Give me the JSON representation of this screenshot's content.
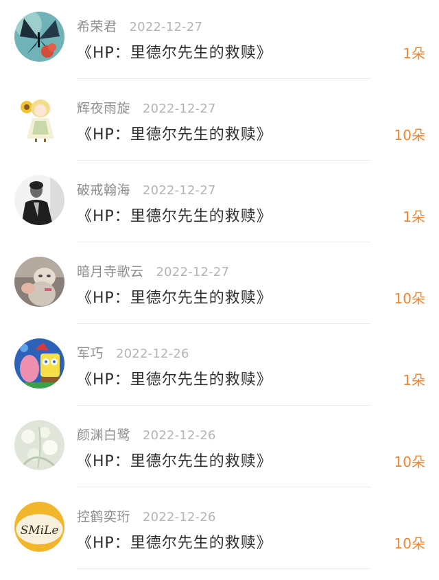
{
  "list": {
    "items": [
      {
        "name": "希荣君",
        "date": "2022-12-27",
        "title": "《HP：里德尔先生的救赎》",
        "amount": "1朵",
        "avatar": "butterfly-avatar"
      },
      {
        "name": "辉夜雨旋",
        "date": "2022-12-27",
        "title": "《HP：里德尔先生的救赎》",
        "amount": "10朵",
        "avatar": "anime-girl-avatar"
      },
      {
        "name": "破戒翰海",
        "date": "2022-12-27",
        "title": "《HP：里德尔先生的救赎》",
        "amount": "1朵",
        "avatar": "man-portrait-avatar"
      },
      {
        "name": "暗月寺歌云",
        "date": "2022-12-27",
        "title": "《HP：里德尔先生的救赎》",
        "amount": "10朵",
        "avatar": "cat-avatar"
      },
      {
        "name": "军巧",
        "date": "2022-12-26",
        "title": "《HP：里德尔先生的救赎》",
        "amount": "1朵",
        "avatar": "cartoon-avatar"
      },
      {
        "name": "颜渊白鹭",
        "date": "2022-12-26",
        "title": "《HP：里德尔先生的救赎》",
        "amount": "10朵",
        "avatar": "flowers-avatar"
      },
      {
        "name": "控鹤奕珩",
        "date": "2022-12-26",
        "title": "《HP：里德尔先生的救赎》",
        "amount": "10朵",
        "avatar": "smile-avatar",
        "avatar_text": "SMiLe"
      }
    ]
  },
  "colors": {
    "amount": "#f0832e",
    "name": "#8d8d8d",
    "date": "#b4b4b4",
    "title": "#2f2f2f"
  }
}
